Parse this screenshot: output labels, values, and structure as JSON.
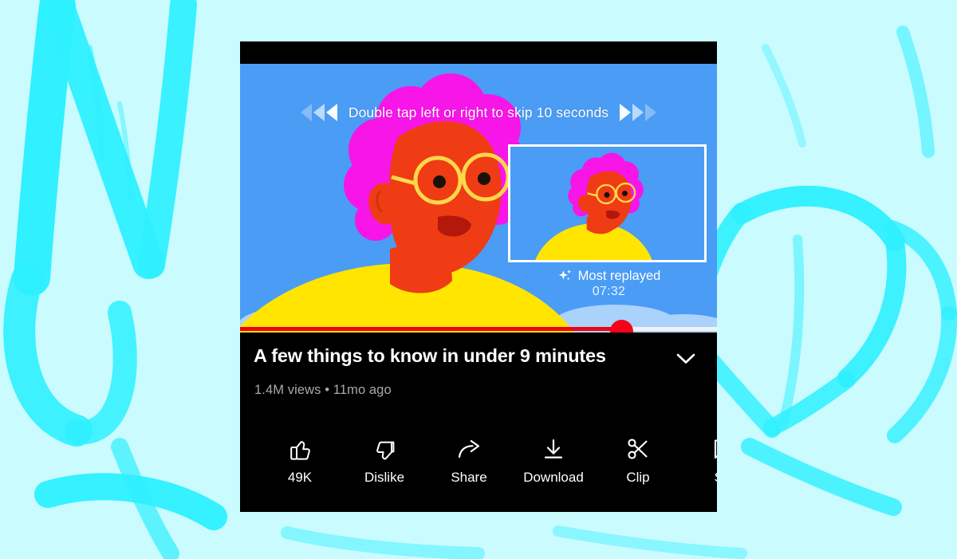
{
  "background": {
    "base_color": "#c9fbff",
    "stroke_color": "#2ef0ff",
    "description": "hand-drawn brush-stroke letterforms"
  },
  "player": {
    "sky_color": "#4a9cf5",
    "hint_text": "Double tap left or right to skip 10 seconds",
    "skip_left_icon": "rewind-triangles-icon",
    "skip_right_icon": "fastforward-triangles-icon",
    "most_replayed": {
      "sparkle_icon": "sparkle-icon",
      "label": "Most replayed",
      "timestamp": "07:32"
    },
    "progress": {
      "percent": 80,
      "fill_color": "#f00016",
      "track_color": "#f0f2f3",
      "handle_color": "#f80018"
    }
  },
  "video": {
    "title": "A few things to know in under 9 minutes",
    "stats": "1.4M views • 11mo ago",
    "collapse_icon": "chevron-down-icon"
  },
  "actions": [
    {
      "icon": "thumbs-up-icon",
      "label": "49K"
    },
    {
      "icon": "thumbs-down-icon",
      "label": "Dislike"
    },
    {
      "icon": "share-arrow-icon",
      "label": "Share"
    },
    {
      "icon": "download-icon",
      "label": "Download"
    },
    {
      "icon": "scissors-icon",
      "label": "Clip"
    },
    {
      "icon": "save-bookmark-icon",
      "label": "Sa"
    }
  ]
}
